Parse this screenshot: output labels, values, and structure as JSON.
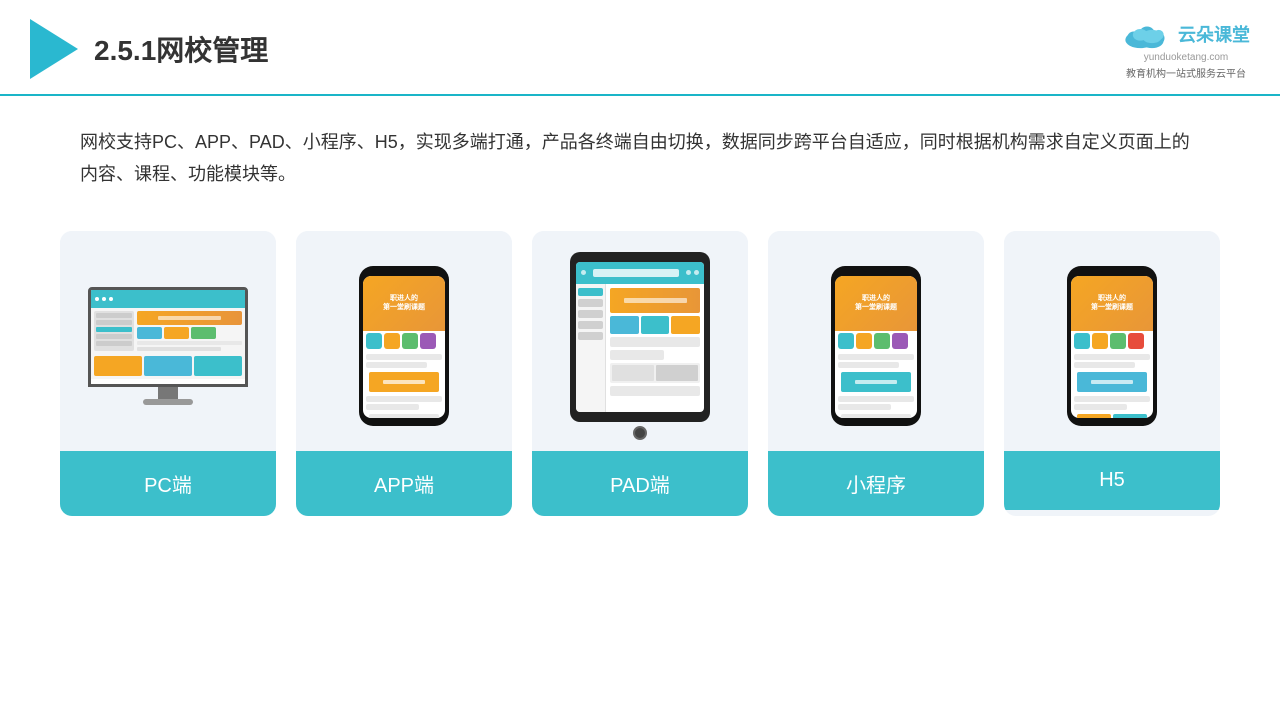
{
  "header": {
    "title": "2.5.1网校管理",
    "logo_name": "云朵课堂",
    "logo_url": "yunduoketang.com",
    "logo_subtitle": "教育机构一站\n式服务云平台"
  },
  "description": {
    "text": "网校支持PC、APP、PAD、小程序、H5，实现多端打通，产品各终端自由切换，数据同步跨平台自适应，同时根据机构需求自定义页面上的内容、课程、功能模块等。"
  },
  "cards": [
    {
      "id": "pc",
      "label": "PC端",
      "type": "pc"
    },
    {
      "id": "app",
      "label": "APP端",
      "type": "phone"
    },
    {
      "id": "pad",
      "label": "PAD端",
      "type": "tablet"
    },
    {
      "id": "miniprogram",
      "label": "小程序",
      "type": "phone"
    },
    {
      "id": "h5",
      "label": "H5",
      "type": "phone"
    }
  ],
  "colors": {
    "accent": "#3cbfcb",
    "accent_dark": "#2ab8d0",
    "text_dark": "#333333",
    "bg_card": "#f0f4f9"
  }
}
